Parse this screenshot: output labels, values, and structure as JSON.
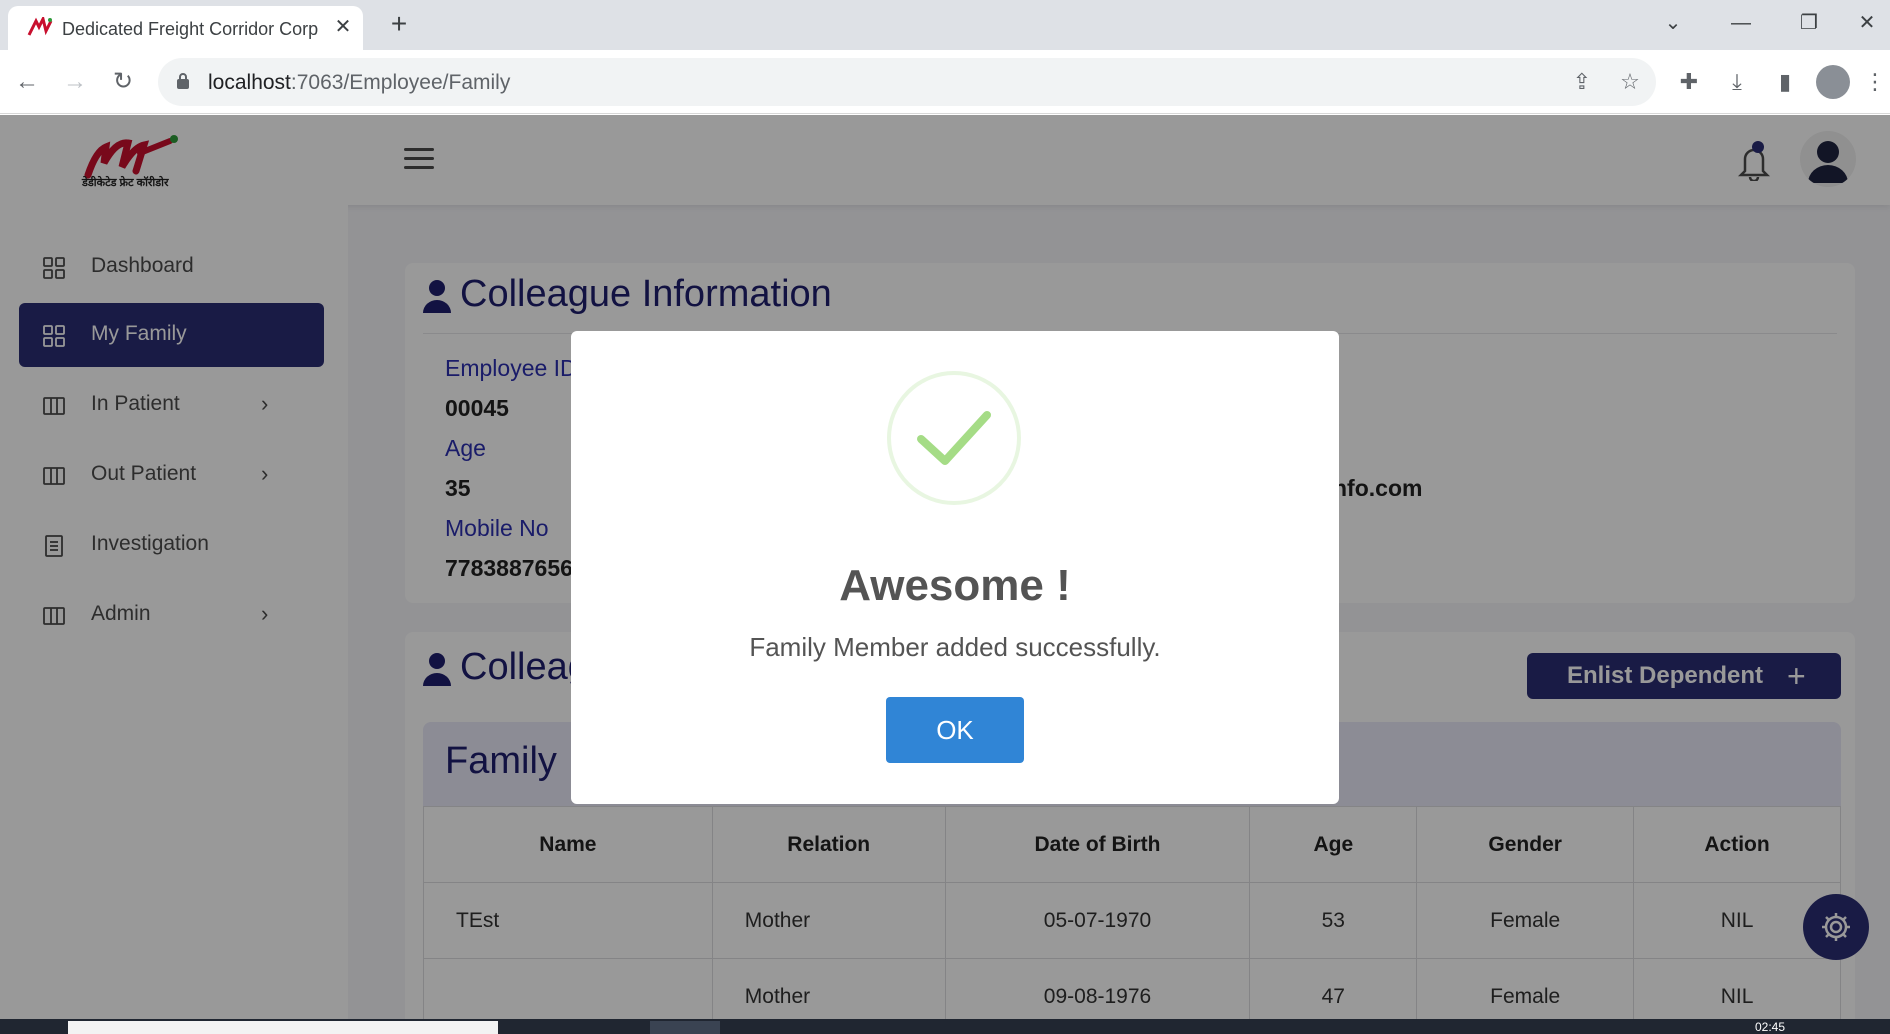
{
  "browser": {
    "tab_title": "Dedicated Freight Corridor Corp",
    "tab_close": "✕",
    "new_tab": "+",
    "url_host": "localhost",
    "url_path": ":7063/Employee/Family",
    "window": {
      "minimize": "—",
      "restore": "❐",
      "close": "✕",
      "tab_search": "⌄"
    }
  },
  "app": {
    "logo_text": "डेडीकेटेड फ्रेट कॉरीडोर",
    "sidebar": {
      "items": [
        {
          "label": "Dashboard",
          "icon": "grid-icon",
          "has_chevron": false
        },
        {
          "label": "My Family",
          "icon": "grid-icon",
          "active": true,
          "has_chevron": false
        },
        {
          "label": "In Patient",
          "icon": "columns-icon",
          "has_chevron": true
        },
        {
          "label": "Out Patient",
          "icon": "columns-icon",
          "has_chevron": true
        },
        {
          "label": "Investigation",
          "icon": "document-icon",
          "has_chevron": false
        },
        {
          "label": "Admin",
          "icon": "columns-icon",
          "has_chevron": true
        }
      ],
      "chevron": "›"
    },
    "colleague_info": {
      "title": "Colleague Information",
      "fields": [
        {
          "label": "Employee ID",
          "value": "00045"
        },
        {
          "label": "Age",
          "value": "35"
        },
        {
          "label": "Mobile No",
          "value": "7783887656"
        }
      ],
      "email_partial": "nfo.com"
    },
    "colleague_family": {
      "title": "Colleague",
      "enlist_button": "Enlist Dependent",
      "enlist_plus": "+",
      "table_title": "Family",
      "columns": [
        "Name",
        "Relation",
        "Date of Birth",
        "Age",
        "Gender",
        "Action"
      ],
      "rows": [
        {
          "name": "TEst",
          "relation": "Mother",
          "dob": "05-07-1970",
          "age": "53",
          "gender": "Female",
          "action": "NIL"
        },
        {
          "name": "",
          "relation": "Mother",
          "dob": "09-08-1976",
          "age": "47",
          "gender": "Female",
          "action": "NIL"
        }
      ]
    }
  },
  "modal": {
    "title": "Awesome !",
    "message": "Family Member added successfully.",
    "ok_label": "OK",
    "success_color": "#a5dc86",
    "button_color": "#3085d6"
  },
  "taskbar": {
    "time": "02:45"
  },
  "colors": {
    "primary": "#2b2d74",
    "heading": "#1f1f6e",
    "label": "#2c2fb0"
  }
}
